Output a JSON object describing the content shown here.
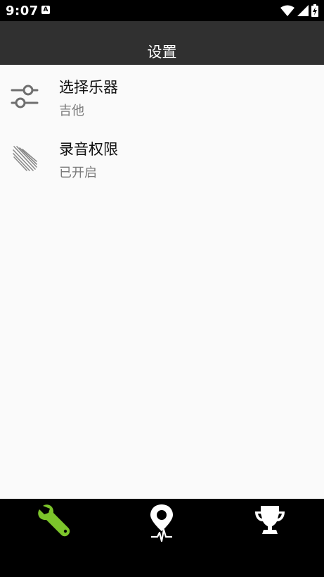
{
  "status_bar": {
    "time": "9:07",
    "notification_icon": "A"
  },
  "toolbar": {
    "title": "设置"
  },
  "settings": {
    "items": [
      {
        "title": "选择乐器",
        "subtitle": "吉他",
        "icon": "sliders-icon"
      },
      {
        "title": "录音权限",
        "subtitle": "已开启",
        "icon": "stripes-icon"
      }
    ]
  },
  "bottom_nav": {
    "items": [
      {
        "icon": "wrench-icon",
        "active": true
      },
      {
        "icon": "map-pin-pulse-icon",
        "active": false
      },
      {
        "icon": "trophy-icon",
        "active": false
      }
    ],
    "active_color": "#7cc42b",
    "inactive_color": "#ffffff"
  },
  "colors": {
    "status_bar": "#000000",
    "toolbar": "#303030",
    "background": "#fafafa",
    "title_text": "#111111",
    "subtitle_text": "#7a7a7a"
  }
}
